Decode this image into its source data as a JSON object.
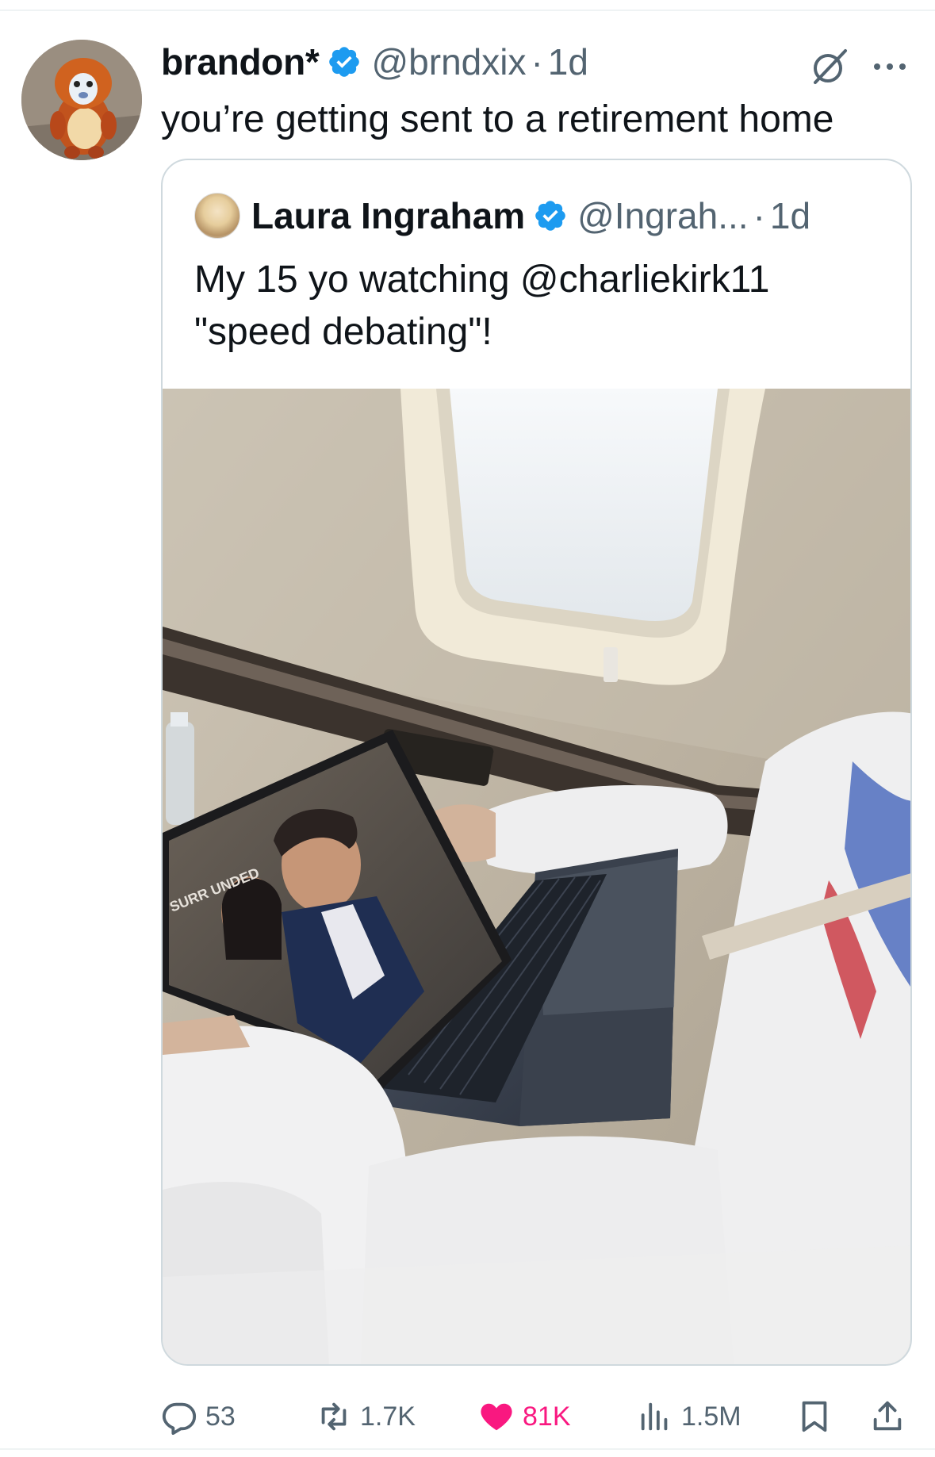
{
  "tweet": {
    "author_name": "brandon*",
    "handle": "@brndxix",
    "separator": "·",
    "time": "1d",
    "text": "you’re getting sent to a retirement home"
  },
  "quoted_tweet": {
    "author_name": "Laura Ingraham",
    "handle": "@Ingrah...",
    "separator": "·",
    "time": "1d",
    "text_lines": [
      "My 15 yo watching @charliekirk11",
      "\"speed debating\"!"
    ],
    "laptop_screen_caption": "SURR UNDED"
  },
  "actions": {
    "replies": "53",
    "reposts": "1.7K",
    "likes": "81K",
    "views": "1.5M"
  },
  "colors": {
    "verified_blue": "#1d9bf0",
    "like_pink": "#f91880",
    "muted_gray": "#536471",
    "border": "#cfd9de"
  },
  "icons": [
    "verified-badge-icon",
    "grok-icon",
    "more-icon",
    "reply-icon",
    "repost-icon",
    "like-icon",
    "views-icon",
    "bookmark-icon",
    "share-icon"
  ]
}
